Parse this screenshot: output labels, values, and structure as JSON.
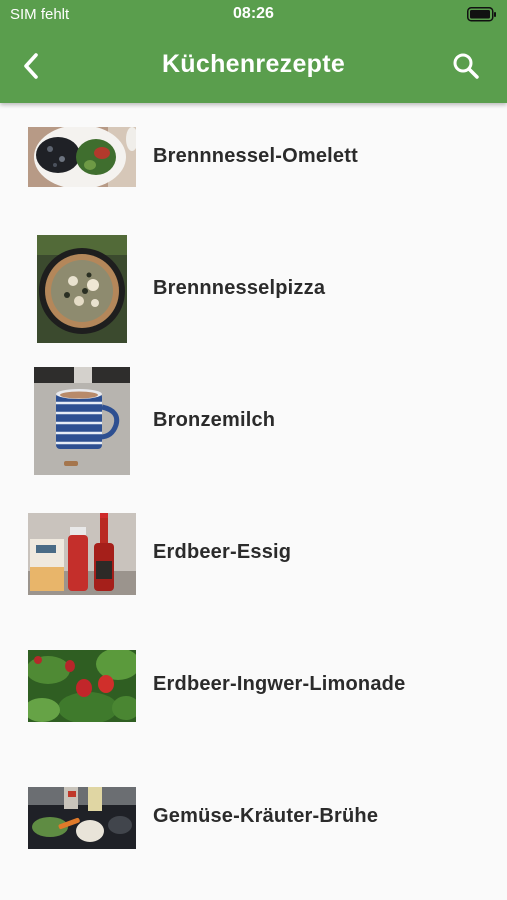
{
  "status_bar": {
    "carrier": "SIM fehlt",
    "time": "08:26"
  },
  "header": {
    "title": "Küchenrezepte",
    "back_icon": "chevron-left-icon",
    "search_icon": "search-icon",
    "color": "#5a9e4d"
  },
  "recipes": [
    {
      "name": "Brennnessel-Omelett",
      "image": "omelette-plate-photo"
    },
    {
      "name": "Brennnesselpizza",
      "image": "pizza-pan-photo"
    },
    {
      "name": "Bronzemilch",
      "image": "striped-mug-photo"
    },
    {
      "name": "Erdbeer-Essig",
      "image": "vinegar-bottles-photo"
    },
    {
      "name": "Erdbeer-Ingwer-Limonade",
      "image": "strawberry-plants-photo"
    },
    {
      "name": "Gemüse-Kräuter-Brühe",
      "image": "vegetables-kitchen-photo"
    }
  ]
}
